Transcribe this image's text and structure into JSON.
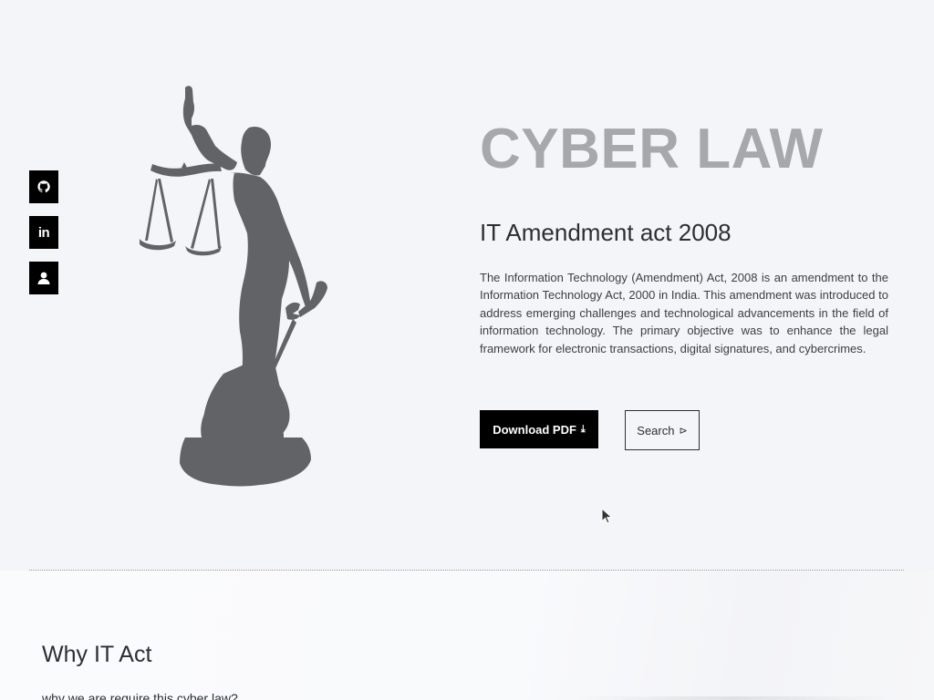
{
  "social": [
    {
      "name": "github",
      "icon": "github-icon"
    },
    {
      "name": "linkedin",
      "icon": "linkedin-icon",
      "glyph": "in"
    },
    {
      "name": "profile",
      "icon": "user-icon"
    }
  ],
  "hero": {
    "title": "CYBER LAW",
    "subtitle": "IT Amendment act 2008",
    "description": "The Information Technology (Amendment) Act, 2008 is an amendment to the Information Technology Act, 2000 in India. This amendment was introduced to address emerging challenges and technological advancements in the field of information technology. The primary objective was to enhance the legal framework for electronic transactions, digital signatures, and cybercrimes.",
    "download_label": "Download PDF",
    "download_icon": "⤓",
    "search_label": "Search",
    "search_icon": "⊳",
    "image": "lady-justice-statue"
  },
  "section": {
    "title": "Why IT Act",
    "subtitle": "why we are require this cyber law?"
  },
  "colors": {
    "background": "#f4f5f8",
    "title_gray": "#a6a8ab",
    "statue": "#626366",
    "button_dark": "#000000"
  }
}
